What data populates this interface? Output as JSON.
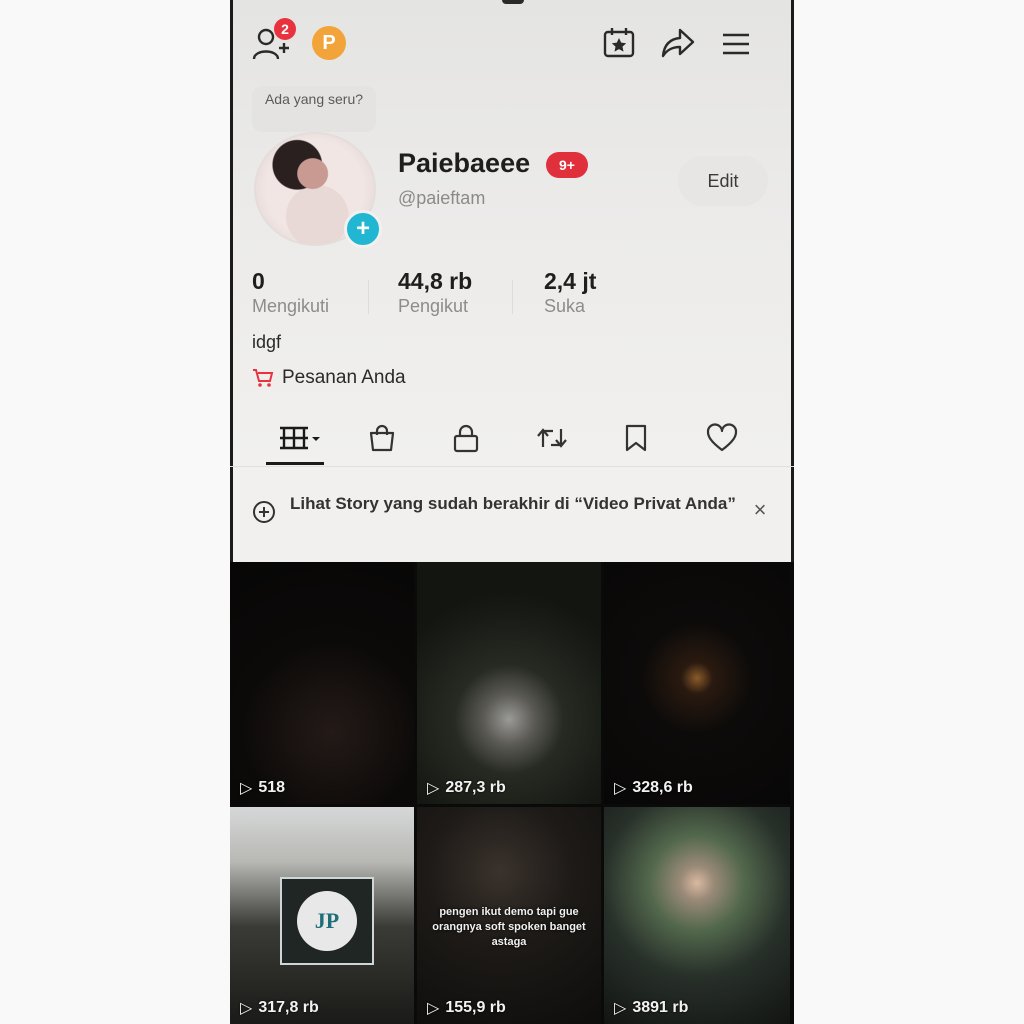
{
  "notifications": {
    "badge": "2"
  },
  "points": {
    "label": "P"
  },
  "bubble": {
    "text": "Ada yang seru?"
  },
  "profile": {
    "display_name": "Paiebaeee",
    "name_badge": "9+",
    "username": "@paieftam",
    "edit_label": "Edit",
    "bio": "idgf",
    "orders_label": "Pesanan Anda"
  },
  "stats": [
    {
      "value": "0",
      "label": "Mengikuti"
    },
    {
      "value": "44,8 rb",
      "label": "Pengikut"
    },
    {
      "value": "2,4 jt",
      "label": "Suka"
    }
  ],
  "tabs": [
    {
      "icon": "videos-grid-icon",
      "active": true
    },
    {
      "icon": "shopping-bag-icon"
    },
    {
      "icon": "lock-icon"
    },
    {
      "icon": "repost-icon"
    },
    {
      "icon": "bookmark-icon"
    },
    {
      "icon": "heart-icon"
    }
  ],
  "story_banner": {
    "text": "Lihat Story yang sudah berakhir di “Video Privat Anda”",
    "close": "×"
  },
  "videos": [
    {
      "views": "518"
    },
    {
      "views": "287,3 rb"
    },
    {
      "views": "328,6 rb"
    },
    {
      "views": "317,8 rb"
    },
    {
      "views": "155,9 rb",
      "caption": "pengen ikut demo tapi gue orangnya soft spoken banget astaga"
    },
    {
      "views": "3891 rb"
    }
  ],
  "colors": {
    "accent_red": "#e8333e",
    "add_blue": "#21b6d2",
    "points_orange": "#f2a43a"
  }
}
